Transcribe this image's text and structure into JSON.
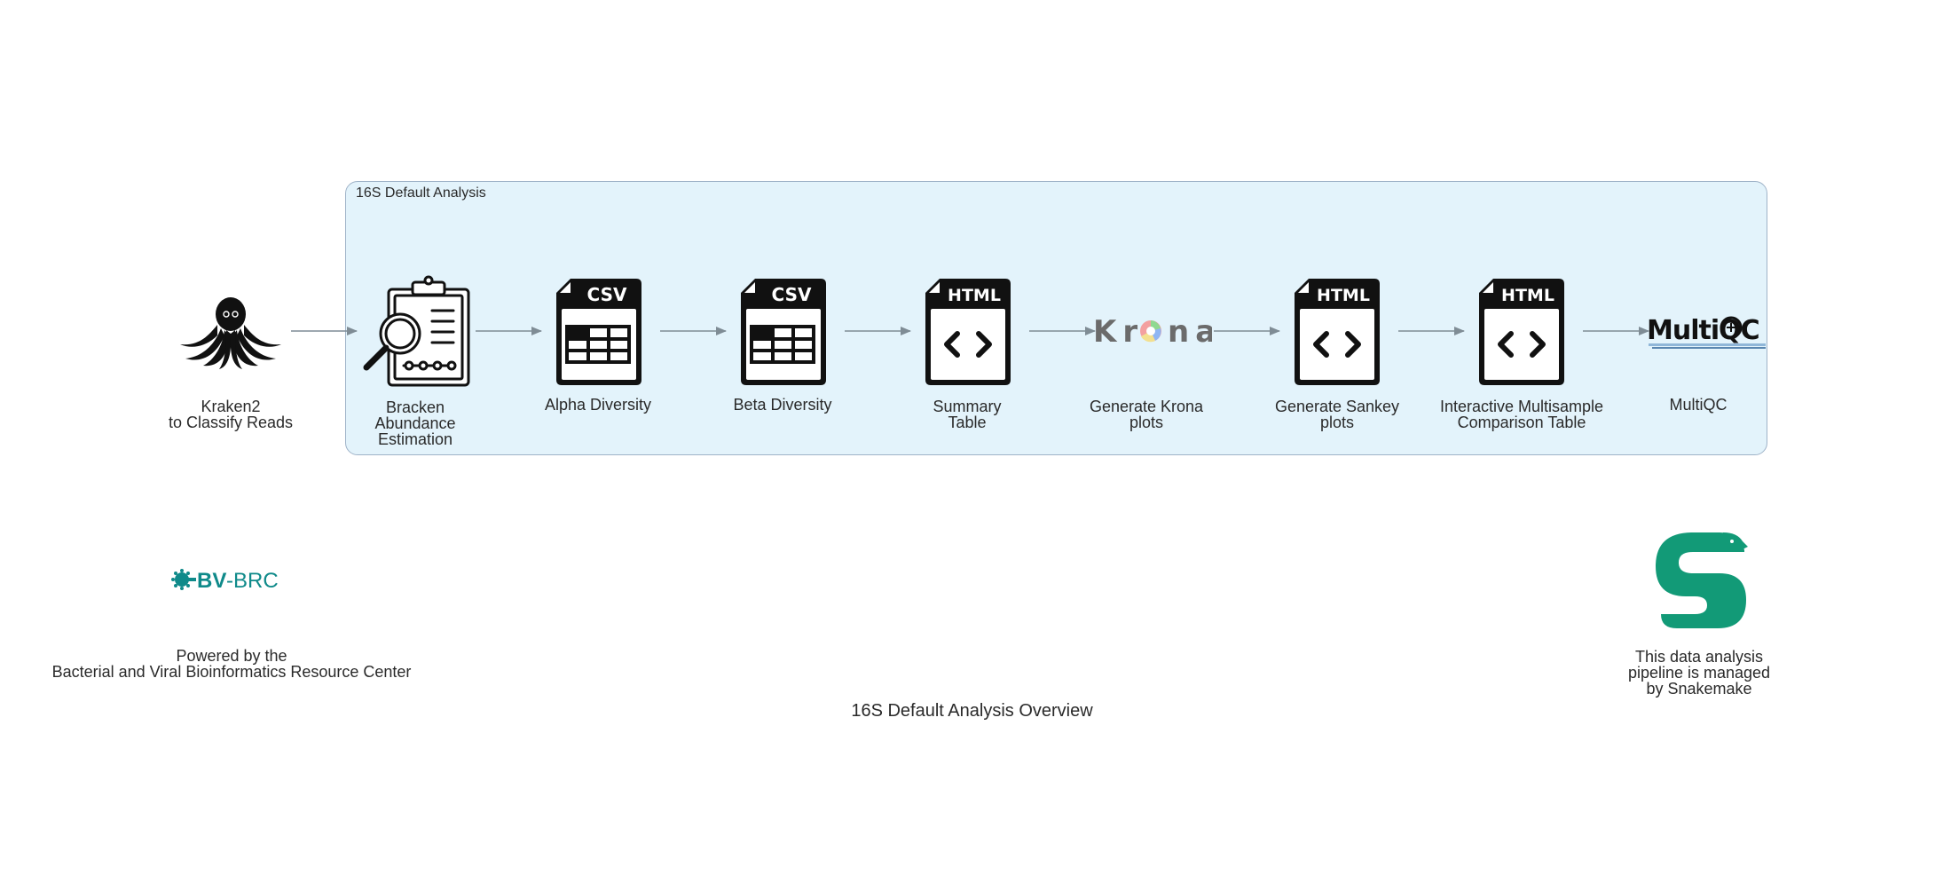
{
  "cluster": {
    "label": "16S Default Analysis"
  },
  "nodes": {
    "kraken": {
      "label": "Kraken2\nto Classify Reads",
      "icon": "octopus-icon"
    },
    "bracken": {
      "label": "Bracken\nAbundance\nEstimation",
      "icon": "clipboard-magnifier-icon"
    },
    "alpha": {
      "label": "Alpha Diversity",
      "badge": "CSV",
      "icon": "csv-file-icon"
    },
    "beta": {
      "label": "Beta Diversity",
      "badge": "CSV",
      "icon": "csv-file-icon"
    },
    "summary": {
      "label": "Summary\nTable",
      "badge": "HTML",
      "icon": "html-file-icon"
    },
    "krona": {
      "label": "Generate Krona\nplots",
      "logo_text": "Krona",
      "icon": "krona-logo"
    },
    "sankey": {
      "label": "Generate Sankey\nplots",
      "badge": "HTML",
      "icon": "html-file-icon"
    },
    "multisample": {
      "label": "Interactive Multisample\nComparison Table",
      "badge": "HTML",
      "icon": "html-file-icon"
    },
    "multiqc": {
      "label": "MultiQC",
      "logo_text": "MultiQC",
      "icon": "multiqc-logo"
    }
  },
  "footer": {
    "bvbrc": {
      "logo_text": "BV-BRC",
      "label": "Powered by the\nBacterial and Viral Bioinformatics Resource Center"
    },
    "snakemake": {
      "label": "This data analysis\npipeline is managed\nby Snakemake",
      "icon": "snakemake-logo"
    }
  },
  "title": "16S Default Analysis Overview",
  "colors": {
    "cluster_fill": "#e3f3fb",
    "cluster_border": "#9fb3c8",
    "edge": "#7f8c95",
    "snakemake": "#129a77",
    "bvbrc": "#0f8a8a"
  }
}
